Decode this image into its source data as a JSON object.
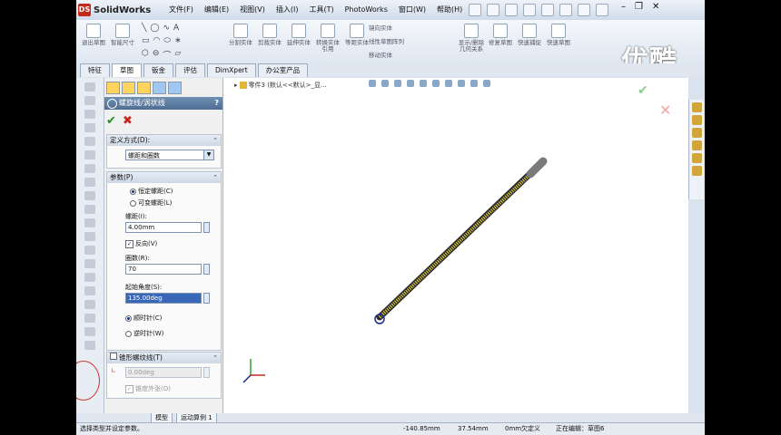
{
  "app": {
    "name": "SolidWorks",
    "logo_badge": "DS"
  },
  "menu": [
    "文件(F)",
    "编辑(E)",
    "视图(V)",
    "插入(I)",
    "工具(T)",
    "PhotoWorks",
    "窗口(W)",
    "帮助(H)"
  ],
  "watermark": "优酷",
  "window_controls": {
    "min": "–",
    "restore": "❐",
    "close": "✕"
  },
  "commands": [
    {
      "label": "退出草图"
    },
    {
      "label": "智能尺寸"
    },
    {
      "label": "分割实体"
    },
    {
      "label": "剪裁实体"
    },
    {
      "label": "延伸实体"
    },
    {
      "label": "转换实体引用"
    },
    {
      "label": "等距实体"
    },
    {
      "label": "显示/删除几何关系"
    },
    {
      "label": "修复草图"
    },
    {
      "label": "快速捕捉"
    },
    {
      "label": "快速草图"
    }
  ],
  "mirror_group": [
    "镜向实体",
    "线性草图阵列",
    "移动实体"
  ],
  "tabs": [
    "特征",
    "草图",
    "钣金",
    "评估",
    "DimXpert",
    "办公室产品"
  ],
  "active_tab": "草图",
  "pm": {
    "title": "螺旋线/涡状线",
    "help": "?",
    "ok": "✔",
    "cancel": "✖",
    "definition": {
      "header": "定义方式(D):",
      "value": "螺距和圈数"
    },
    "params": {
      "header": "参数(P)",
      "constant_pitch": "恒定螺距(C)",
      "variable_pitch": "可变螺距(L)",
      "pitch_label": "螺距(I):",
      "pitch_value": "4.00mm",
      "reverse": "反向(V)",
      "revs_label": "圈数(R):",
      "revs_value": "70",
      "start_angle_label": "起始角度(S):",
      "start_angle_value": "135.00deg",
      "clockwise": "顺时针(C)",
      "counterclockwise": "逆时针(W)"
    },
    "taper": {
      "header": "锥形螺纹线(T)",
      "value": "0.00deg",
      "outward": "锥度外张(O)"
    }
  },
  "gfx": {
    "tree_root": "零件3 (默认<<默认>_显..."
  },
  "bottom_tabs": [
    "模型",
    "运动算例 1"
  ],
  "status": {
    "hint": "选择类型并设定参数。",
    "x": "-140.85mm",
    "y": "37.54mm",
    "z": "0mm",
    "state": "欠定义",
    "editing": "正在编辑：草图6"
  },
  "colors": {
    "helix": "#f5e03a",
    "accent": "#4d6d93"
  }
}
